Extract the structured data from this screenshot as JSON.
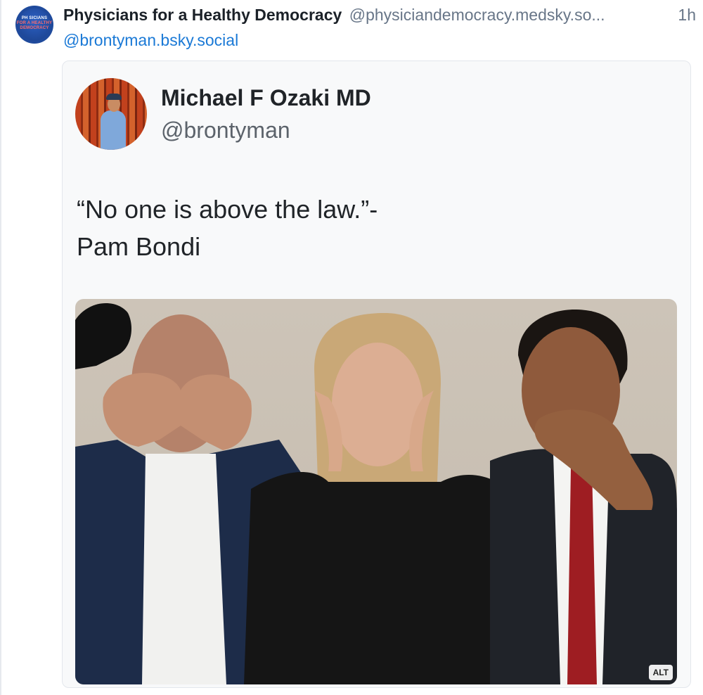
{
  "post": {
    "author_avatar_text_1": "PH SICIANS",
    "author_avatar_text_2": "FOR A HEALTHY DEMOCRACY",
    "display_name": "Physicians for a Healthy Democracy",
    "handle": "@physiciandemocracy.medsky.so...",
    "time": "1h",
    "mention": "@brontyman.bsky.social"
  },
  "embed": {
    "display_name": "Michael F Ozaki MD",
    "handle": "@brontyman",
    "text_lines": [
      "“No one is above the law.”-",
      "Pam Bondi"
    ],
    "alt_badge": "ALT"
  },
  "colors": {
    "link": "#1a79d6",
    "muted": "#687688",
    "text": "#1b2128"
  }
}
